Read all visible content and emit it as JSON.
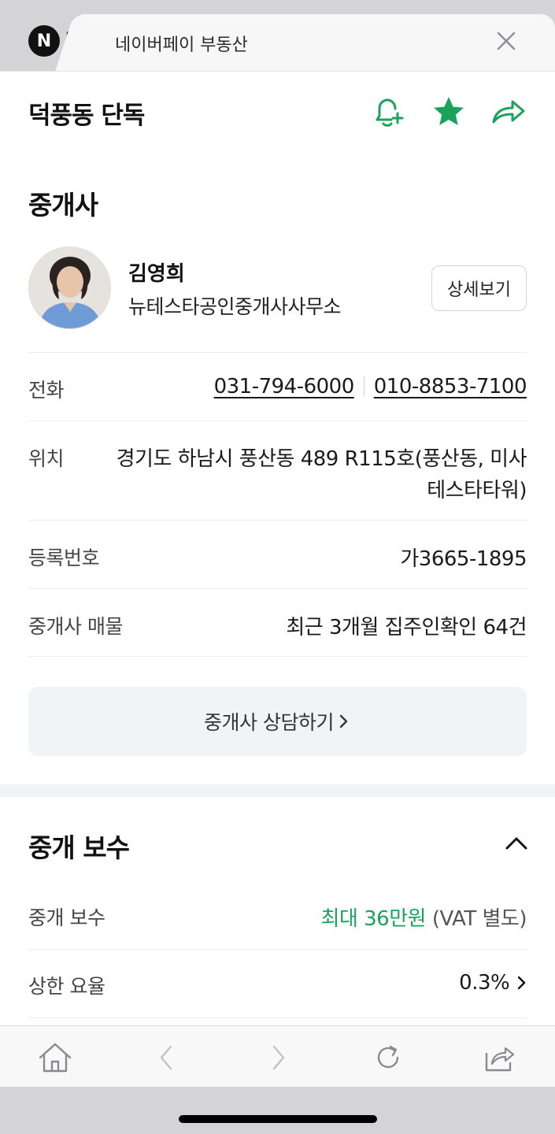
{
  "tab": {
    "logo_letter": "N",
    "logo_text": "p",
    "title": "네이버페이 부동산"
  },
  "header": {
    "title": "덕풍동 단독"
  },
  "broker": {
    "section_title": "중개사",
    "name": "김영희",
    "office": "뉴테스타공인중개사사무소",
    "detail_button": "상세보기",
    "rows": {
      "phone": {
        "label": "전화",
        "phone1": "031-794-6000",
        "phone2": "010-8853-7100"
      },
      "location": {
        "label": "위치",
        "line1": "경기도 하남시 풍산동 489 R115호(풍산동, 미사",
        "line2": "테스타타워)"
      },
      "registration": {
        "label": "등록번호",
        "value": "가3665-1895"
      },
      "listings": {
        "label": "중개사 매물",
        "value": "최근 3개월 집주인확인 64건"
      }
    },
    "consult_button": "중개사 상담하기"
  },
  "fee": {
    "section_title": "중개 보수",
    "rows": {
      "fee": {
        "label": "중개 보수",
        "value_highlight": "최대 36만원",
        "value_note": "(VAT 별도)"
      },
      "rate": {
        "label": "상한 요율",
        "value": "0.3%"
      }
    }
  },
  "colors": {
    "accent_green": "#1aa35b"
  }
}
